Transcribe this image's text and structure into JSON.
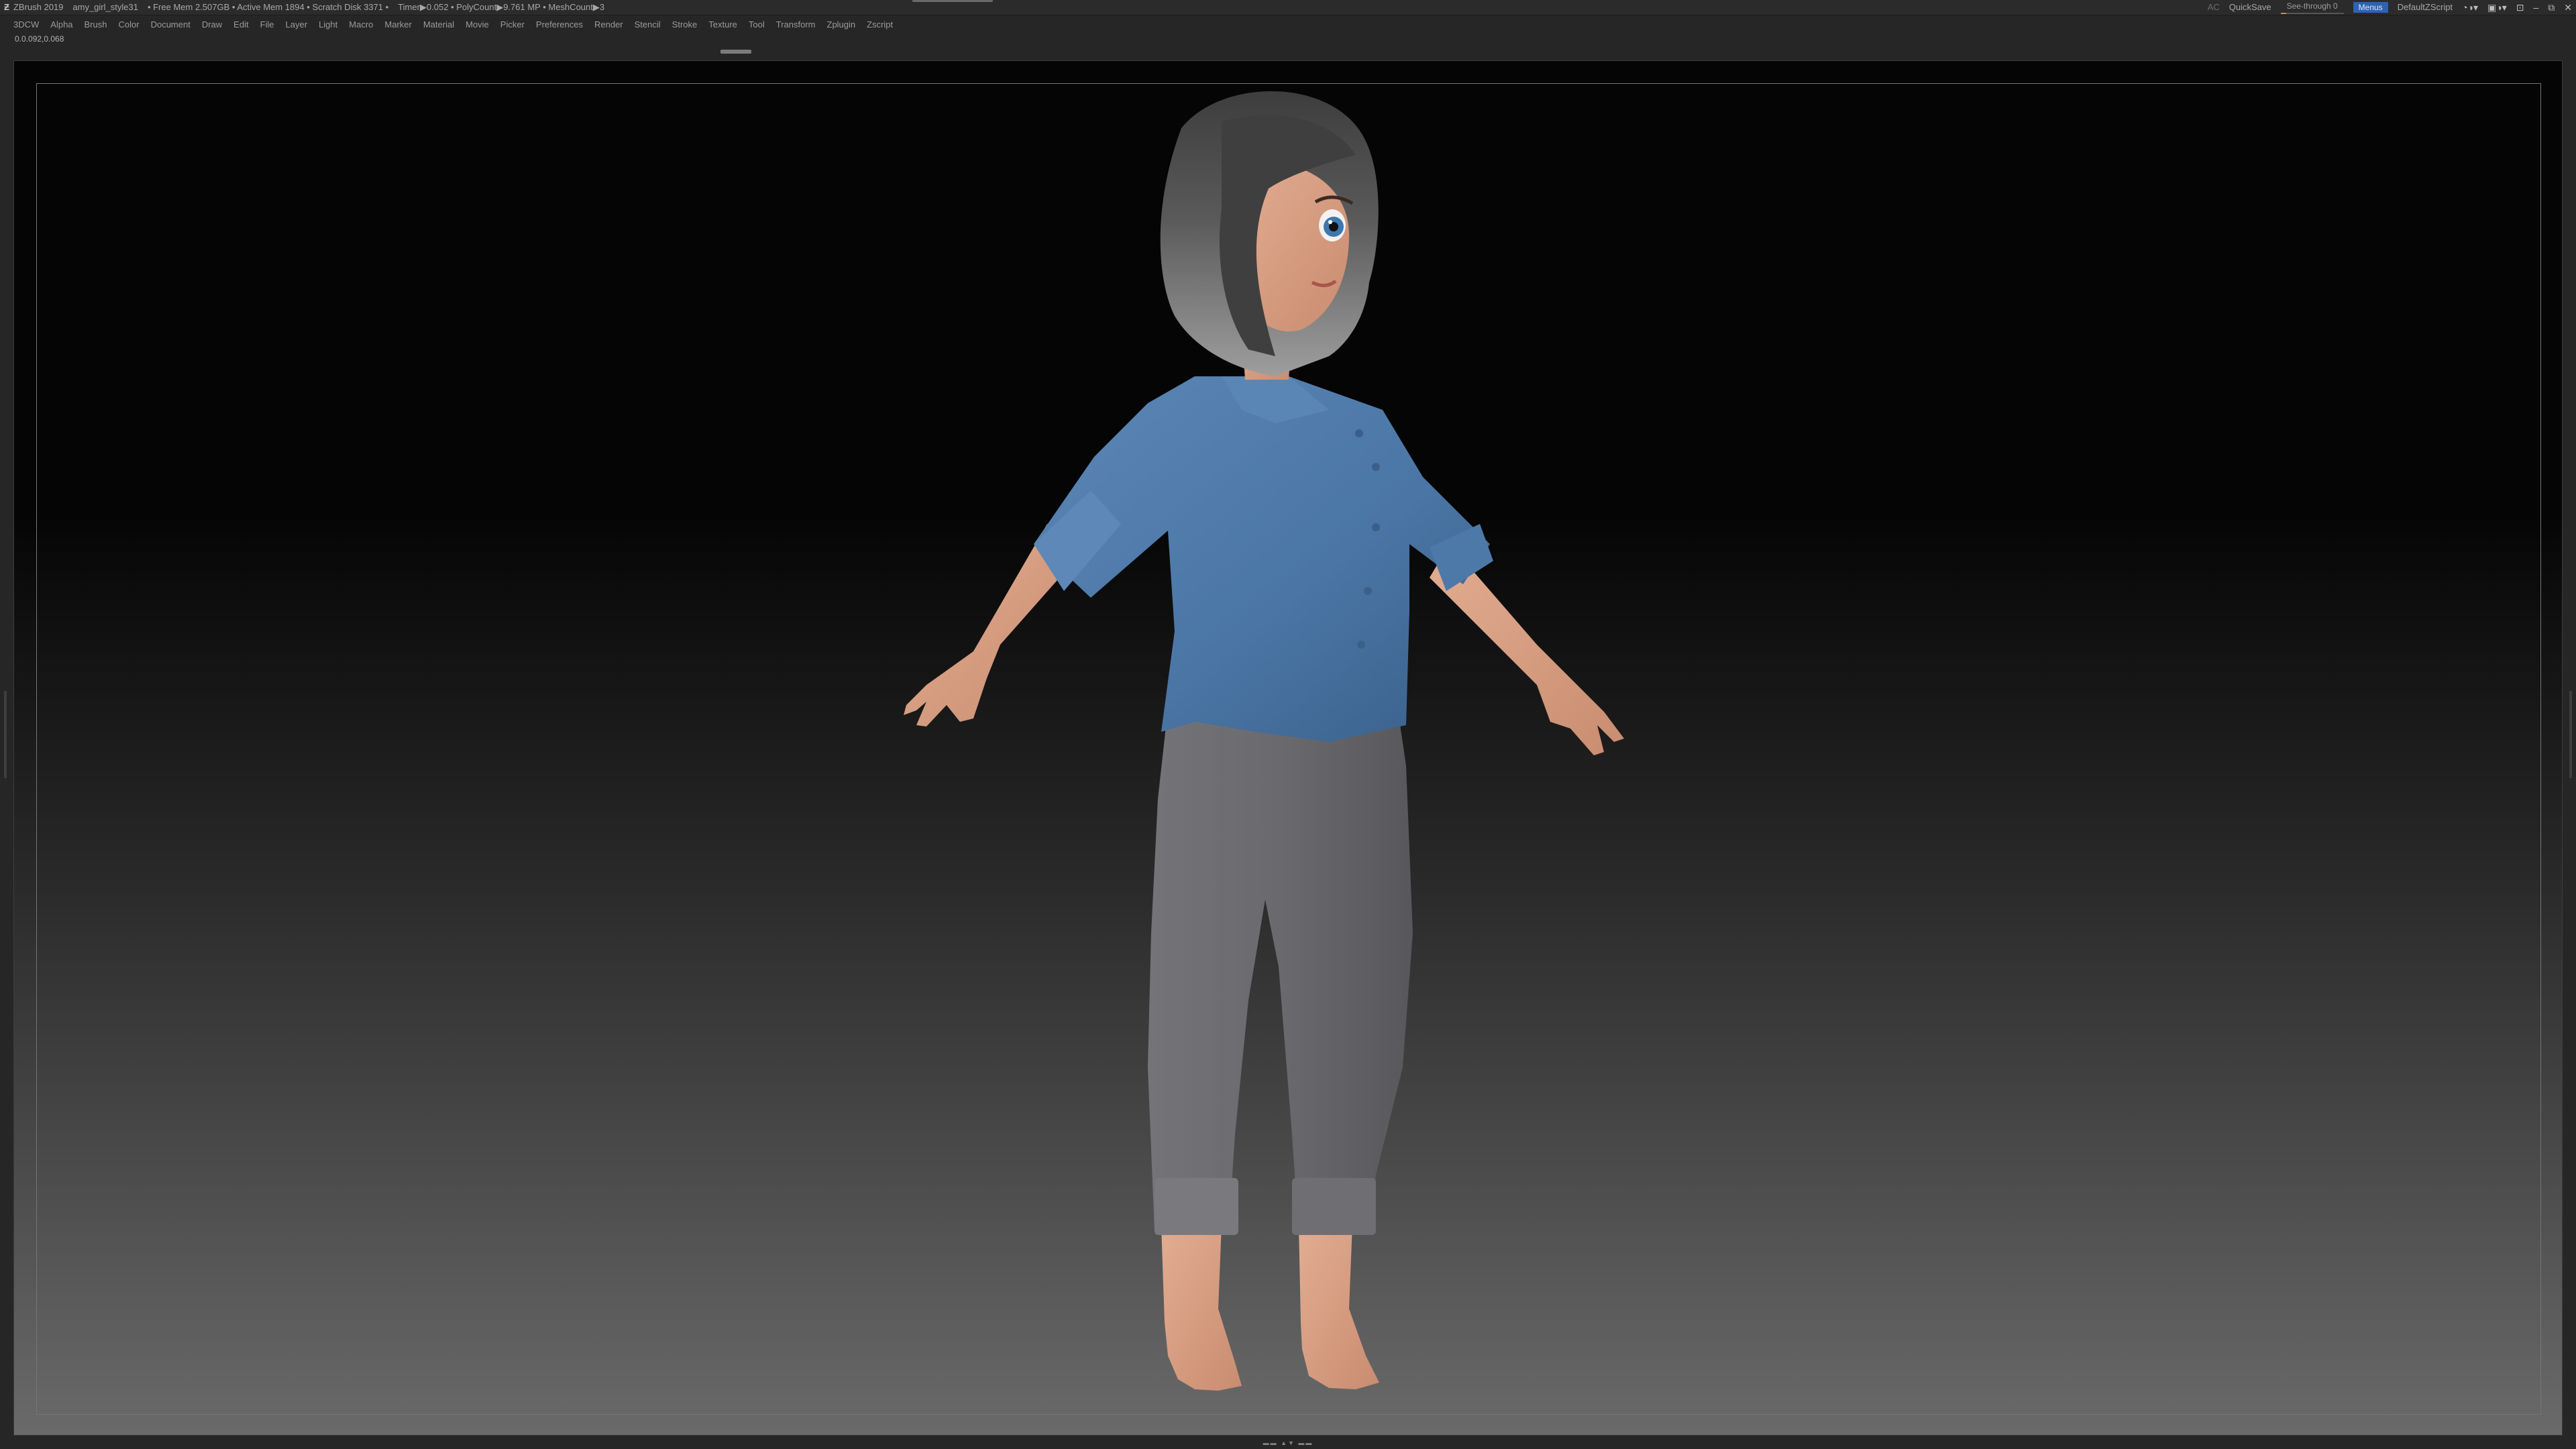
{
  "titlebar": {
    "app": "ZBrush 2019",
    "filename": "amy_girl_style31",
    "stats": "• Free Mem 2.507GB • Active Mem 1894 • Scratch Disk 3371 •",
    "timer": "Timer▶0.052 • PolyCount▶9.761 MP • MeshCount▶3",
    "ac": "AC",
    "quicksave": "QuickSave",
    "see_through": "See-through 0",
    "see_through_value": 0,
    "menus": "Menus",
    "zscript": "DefaultZScript"
  },
  "menu": [
    "3DCW",
    "Alpha",
    "Brush",
    "Color",
    "Document",
    "Draw",
    "Edit",
    "File",
    "Layer",
    "Light",
    "Macro",
    "Marker",
    "Material",
    "Movie",
    "Picker",
    "Preferences",
    "Render",
    "Stencil",
    "Stroke",
    "Texture",
    "Tool",
    "Transform",
    "Zplugin",
    "Zscript"
  ],
  "coords": "0.0.092,0.068",
  "icons": {
    "app": "zbrush-logo-icon",
    "help": "help-icon",
    "layout": "layout-icon",
    "minimize": "minimize-icon",
    "maximize": "maximize-icon",
    "close": "close-icon"
  },
  "colors": {
    "accent_blue": "#2d63b2",
    "slider_orange": "#e2841a",
    "shirt": "#4b77a6",
    "pants": "#6a6a6d",
    "skin": "#d79f83",
    "hair": "#4a4a4a"
  }
}
